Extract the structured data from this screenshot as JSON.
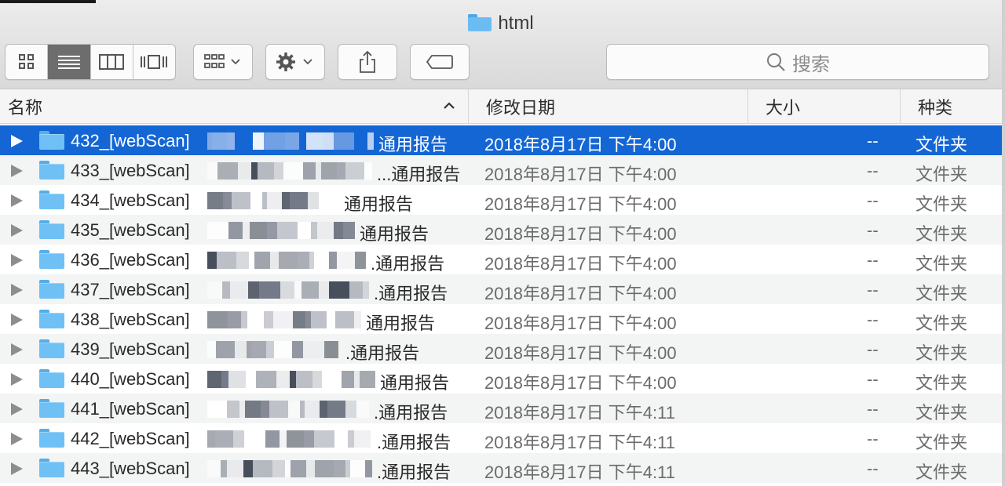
{
  "window": {
    "title": "html"
  },
  "toolbar": {
    "views": [
      {
        "name": "icon-view",
        "active": false
      },
      {
        "name": "list-view",
        "active": true
      },
      {
        "name": "column-view",
        "active": false
      },
      {
        "name": "cover-flow-view",
        "active": false
      }
    ],
    "search_placeholder": "搜索"
  },
  "columns": {
    "name": "名称",
    "date": "修改日期",
    "size": "大小",
    "kind": "种类"
  },
  "rows": [
    {
      "id": "432_[webScan]",
      "suffix": "通用报告",
      "date": "2018年8月17日 下午4:00",
      "size": "--",
      "kind": "文件夹",
      "selected": true
    },
    {
      "id": "433_[webScan]",
      "suffix": "...通用报告",
      "date": "2018年8月17日 下午4:00",
      "size": "--",
      "kind": "文件夹",
      "selected": false
    },
    {
      "id": "434_[webScan]",
      "suffix": "通用报告",
      "date": "2018年8月17日 下午4:00",
      "size": "--",
      "kind": "文件夹",
      "selected": false
    },
    {
      "id": "435_[webScan]",
      "suffix": "通用报告",
      "date": "2018年8月17日 下午4:00",
      "size": "--",
      "kind": "文件夹",
      "selected": false
    },
    {
      "id": "436_[webScan]",
      "suffix": ".通用报告",
      "date": "2018年8月17日 下午4:00",
      "size": "--",
      "kind": "文件夹",
      "selected": false
    },
    {
      "id": "437_[webScan]",
      "suffix": ".通用报告",
      "date": "2018年8月17日 下午4:00",
      "size": "--",
      "kind": "文件夹",
      "selected": false
    },
    {
      "id": "438_[webScan]",
      "suffix": "通用报告",
      "date": "2018年8月17日 下午4:00",
      "size": "--",
      "kind": "文件夹",
      "selected": false
    },
    {
      "id": "439_[webScan]",
      "suffix": ".通用报告",
      "date": "2018年8月17日 下午4:00",
      "size": "--",
      "kind": "文件夹",
      "selected": false
    },
    {
      "id": "440_[webScan]",
      "suffix": "通用报告",
      "date": "2018年8月17日 下午4:00",
      "size": "--",
      "kind": "文件夹",
      "selected": false
    },
    {
      "id": "441_[webScan]",
      "suffix": ".通用报告",
      "date": "2018年8月17日 下午4:11",
      "size": "--",
      "kind": "文件夹",
      "selected": false
    },
    {
      "id": "442_[webScan]",
      "suffix": ".通用报告",
      "date": "2018年8月17日 下午4:11",
      "size": "--",
      "kind": "文件夹",
      "selected": false
    },
    {
      "id": "443_[webScan]",
      "suffix": ".通用报告",
      "date": "2018年8月17日 下午4:11",
      "size": "--",
      "kind": "文件夹",
      "selected": false
    }
  ],
  "colors": {
    "selection": "#1466d4",
    "folder": "#6fc0f5",
    "header_bg": "#f5f5f5"
  }
}
